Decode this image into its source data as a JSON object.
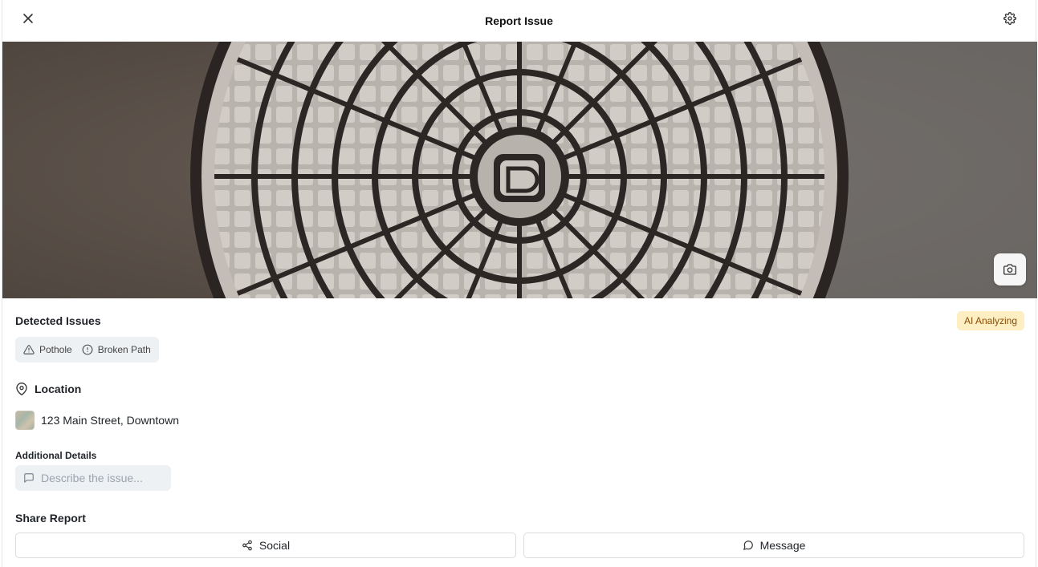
{
  "header": {
    "title": "Report Issue"
  },
  "detected": {
    "title": "Detected Issues",
    "status_badge": "AI Analyzing",
    "tags": [
      {
        "label": "Pothole",
        "icon": "warning-triangle-icon"
      },
      {
        "label": "Broken Path",
        "icon": "alert-circle-icon"
      }
    ]
  },
  "location": {
    "title": "Location",
    "address": "123 Main Street, Downtown"
  },
  "details": {
    "label": "Additional Details",
    "placeholder": "Describe the issue...",
    "value": ""
  },
  "share": {
    "title": "Share Report",
    "social_label": "Social",
    "message_label": "Message"
  },
  "colors": {
    "badge_bg": "#fdefc2",
    "badge_text": "#8a4b06",
    "chip_bg": "#eef1f4"
  }
}
